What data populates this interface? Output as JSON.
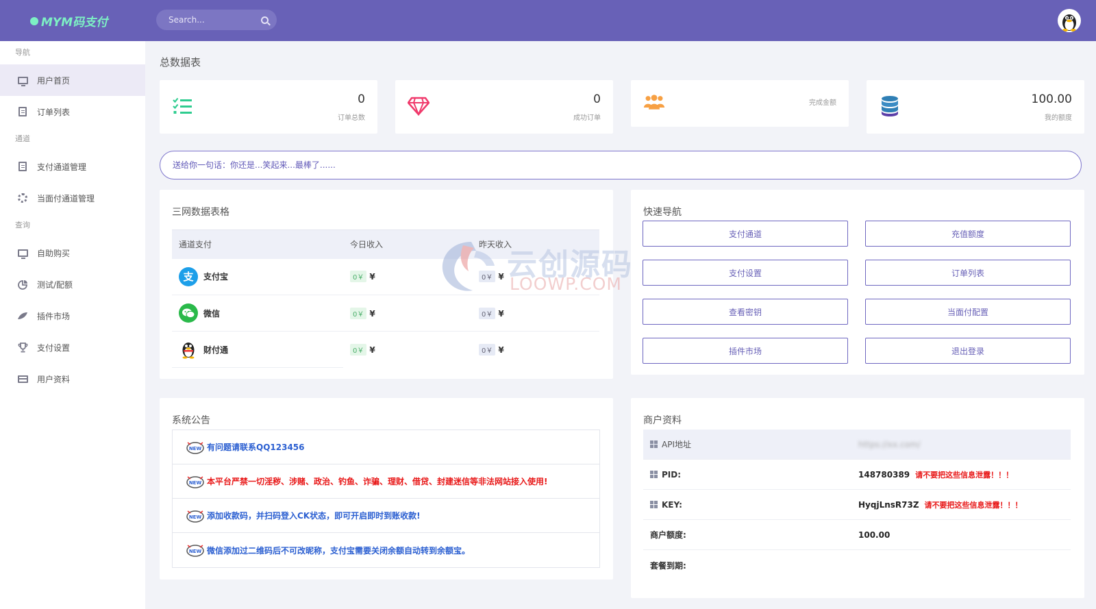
{
  "header": {
    "logo_text": "MYM码支付",
    "search_placeholder": "Search..."
  },
  "sidebar": {
    "sections": [
      {
        "label": "导航",
        "items": [
          {
            "label": "用户首页",
            "icon": "monitor-icon",
            "active": true
          },
          {
            "label": "订单列表",
            "icon": "document-icon"
          }
        ]
      },
      {
        "label": "通道",
        "items": [
          {
            "label": "支付通道管理",
            "icon": "document-icon"
          },
          {
            "label": "当面付通道管理",
            "icon": "lifebuoy-icon"
          }
        ]
      },
      {
        "label": "查询",
        "items": [
          {
            "label": "自助购买",
            "icon": "monitor-icon"
          },
          {
            "label": "测试/配额",
            "icon": "pie-chart-icon"
          },
          {
            "label": "插件市场",
            "icon": "leaf-icon"
          },
          {
            "label": "支付设置",
            "icon": "trophy-icon"
          },
          {
            "label": "用户资料",
            "icon": "card-icon"
          }
        ]
      }
    ]
  },
  "main": {
    "title": "总数据表",
    "stats": [
      {
        "value": "0",
        "label": "订单总数",
        "icon": "checklist-icon",
        "color": "#2ecc8f"
      },
      {
        "value": "0",
        "label": "成功订单",
        "icon": "diamond-icon",
        "color": "#f0396b"
      },
      {
        "value": "",
        "label": "完成金额",
        "icon": "users-icon",
        "color": "#f7a043"
      },
      {
        "value": "100.00",
        "label": "我的额度",
        "icon": "database-icon",
        "color": "#2f7fb5"
      }
    ],
    "quote": "送给你一句话：你还是...笑起来...最棒了......"
  },
  "sanwang": {
    "title": "三网数据表格",
    "headers": [
      "通道支付",
      "今日收入",
      "昨天收入"
    ],
    "rows": [
      {
        "name": "支付宝",
        "icon": "alipay-icon",
        "today": "0￥",
        "yesterday": "0￥",
        "currency": "¥"
      },
      {
        "name": "微信",
        "icon": "wechat-icon",
        "today": "0￥",
        "yesterday": "0￥",
        "currency": "¥"
      },
      {
        "name": "财付通",
        "icon": "qq-penguin-icon",
        "today": "0￥",
        "yesterday": "0￥",
        "currency": "¥"
      }
    ]
  },
  "quicknav": {
    "title": "快速导航",
    "buttons": [
      "支付通道",
      "充值额度",
      "支付设置",
      "订单列表",
      "查看密钥",
      "当面付配置",
      "插件市场",
      "退出登录"
    ]
  },
  "notices": {
    "title": "系统公告",
    "items": [
      {
        "text": "有问题请联系QQ123456",
        "color": "blue"
      },
      {
        "text": "本平台严禁一切淫秽、涉赌、政治、钓鱼、诈骗、理财、借贷、封建迷信等非法网站接入使用!",
        "color": "red"
      },
      {
        "text": "添加收款码，并扫码登入CK状态，即可开启即时到账收款!",
        "color": "blue"
      },
      {
        "text": "微信添加过二维码后不可改昵称，支付宝需要关闭余额自动转到余额宝。",
        "color": "blue"
      }
    ]
  },
  "merchant": {
    "title": "商户资料",
    "rows": [
      {
        "key": "API地址",
        "value": "https://xx.com/",
        "warn": "",
        "icon": true,
        "plain": true,
        "blurred": true
      },
      {
        "key": "PID:",
        "value": "148780389",
        "warn": "请不要把这些信息泄露！！！",
        "icon": true
      },
      {
        "key": "KEY:",
        "value": "HyqjLnsR73Z",
        "warn": "请不要把这些信息泄露！！！",
        "icon": true
      },
      {
        "key": "商户额度:",
        "value": "100.00",
        "warn": "",
        "icon": false
      },
      {
        "key": "套餐到期:",
        "value": "",
        "warn": "",
        "icon": false
      }
    ]
  },
  "watermark": {
    "line1": "云创源码",
    "line2": "LOOWP.COM"
  }
}
